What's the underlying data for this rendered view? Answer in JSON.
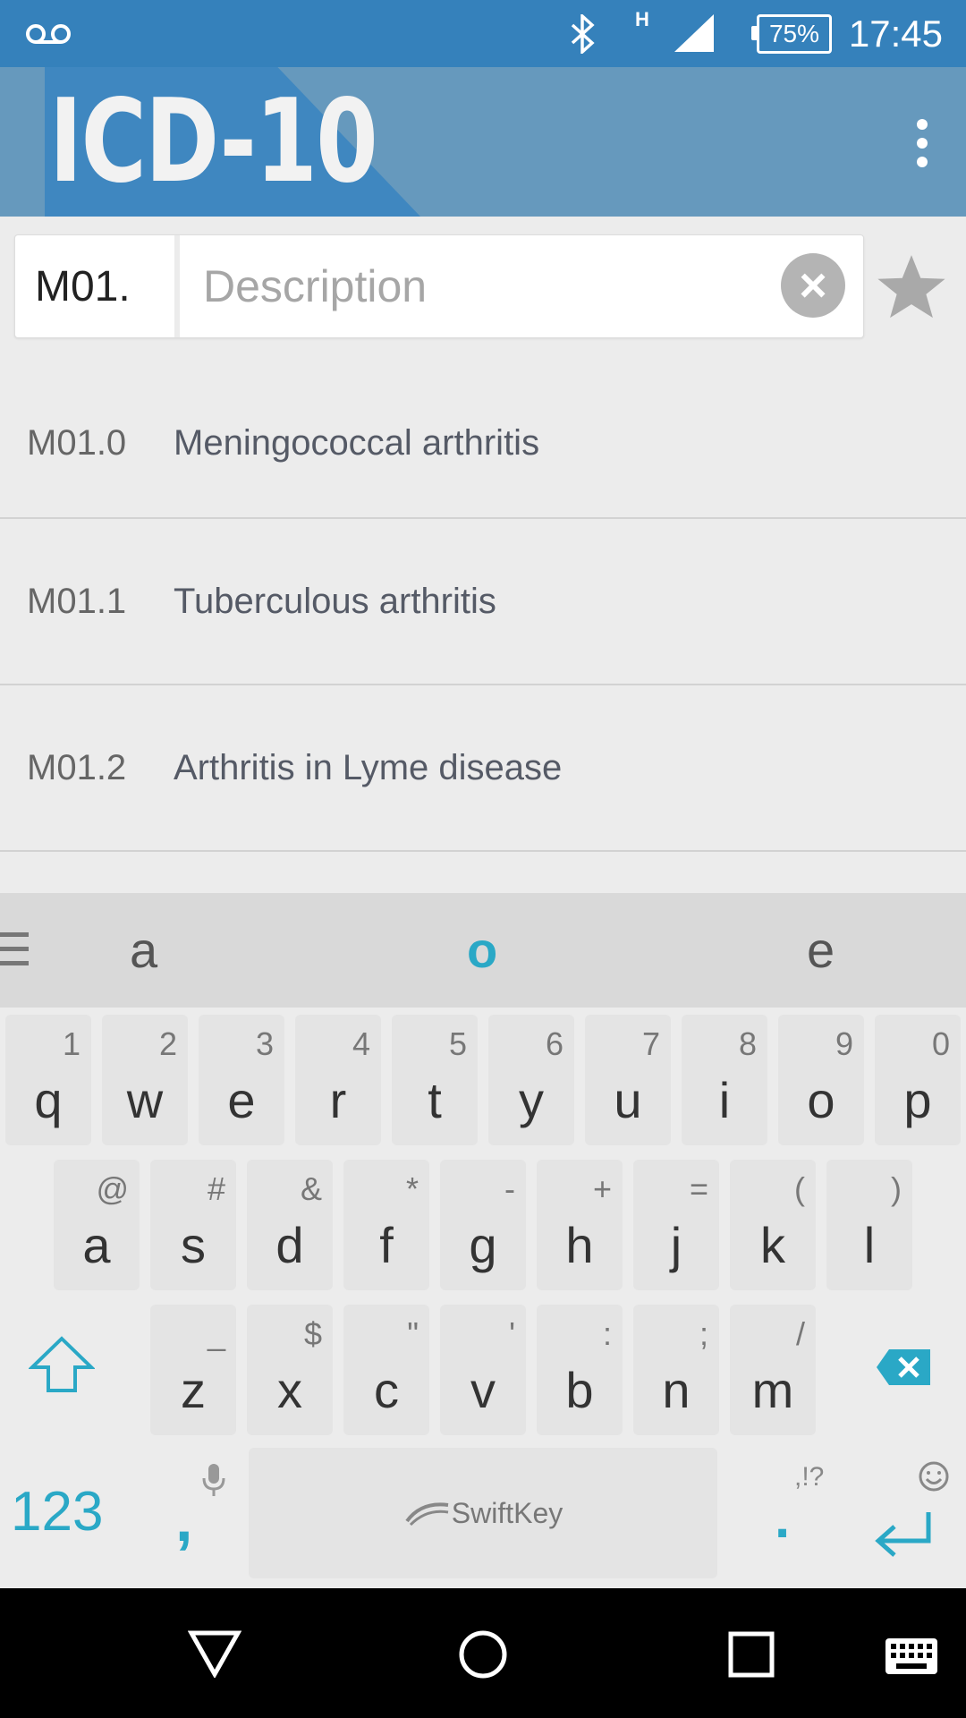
{
  "status_bar": {
    "voicemail_icon": "voicemail-icon",
    "bluetooth_icon": "bluetooth-icon",
    "network_type": "H",
    "signal_icon": "signal-icon",
    "battery": "75%",
    "time": "17:45"
  },
  "app_bar": {
    "logo": "ICD-10",
    "overflow_icon": "more-vert-icon"
  },
  "search": {
    "code_value": "M01.",
    "description_placeholder": "Description",
    "clear_icon": "clear-icon",
    "favorite_icon": "star-icon"
  },
  "results": [
    {
      "code": "M01.0",
      "description": "Meningococcal arthritis"
    },
    {
      "code": "M01.1",
      "description": "Tuberculous arthritis"
    },
    {
      "code": "M01.2",
      "description": "Arthritis in Lyme disease"
    }
  ],
  "keyboard": {
    "suggestions": [
      "a",
      "o",
      "e"
    ],
    "highlighted_suggestion": "o",
    "row1": [
      [
        "q",
        "1"
      ],
      [
        "w",
        "2"
      ],
      [
        "e",
        "3"
      ],
      [
        "r",
        "4"
      ],
      [
        "t",
        "5"
      ],
      [
        "y",
        "6"
      ],
      [
        "u",
        "7"
      ],
      [
        "i",
        "8"
      ],
      [
        "o",
        "9"
      ],
      [
        "p",
        "0"
      ]
    ],
    "row2": [
      [
        "a",
        "@"
      ],
      [
        "s",
        "#"
      ],
      [
        "d",
        "&"
      ],
      [
        "f",
        "*"
      ],
      [
        "g",
        "-"
      ],
      [
        "h",
        "+"
      ],
      [
        "j",
        "="
      ],
      [
        "k",
        "("
      ],
      [
        "l",
        ")"
      ]
    ],
    "row3": [
      [
        "z",
        "_"
      ],
      [
        "x",
        "$"
      ],
      [
        "c",
        "\""
      ],
      [
        "v",
        "'"
      ],
      [
        "b",
        ":"
      ],
      [
        "n",
        ";"
      ],
      [
        "m",
        "/"
      ]
    ],
    "numbers_key": "123",
    "comma_key": ",",
    "period_key": ".",
    "punct_hint": ",!?",
    "space_brand": "SwiftKey",
    "accent_color": "#2aa8c6"
  },
  "nav_bar": {
    "back_icon": "back-icon",
    "home_icon": "home-icon",
    "recents_icon": "recents-icon",
    "keyboard_icon": "keyboard-icon"
  }
}
